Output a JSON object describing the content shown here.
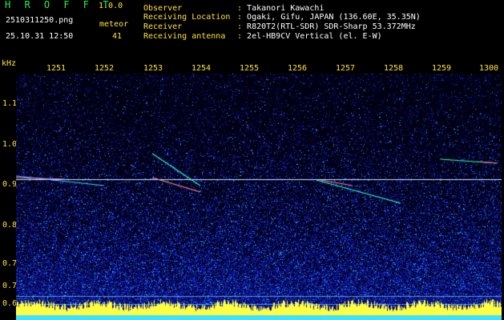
{
  "app": {
    "name": "H R O F F T",
    "version": "1.0.0"
  },
  "file": "2510311250.png",
  "timestamp": "25.10.31 12:50",
  "meteor": {
    "label": "meteor",
    "count": "41"
  },
  "info": [
    {
      "label": "Observer",
      "value": "Takanori Kawachi"
    },
    {
      "label": "Receiving Location",
      "value": "Ogaki, Gifu, JAPAN (136.60E, 35.35N)"
    },
    {
      "label": "Receiver",
      "value": "R820T2(RTL-SDR) SDR-Sharp 53.372MHz"
    },
    {
      "label": "Receiving antenna",
      "value": "2el-HB9CV Vertical (el. E-W)"
    }
  ],
  "axis": {
    "y_unit": "kHz",
    "y_ticks": [
      "1.1",
      "1.0",
      "0.9",
      "0.8",
      "0.75",
      "0.7",
      "0.6"
    ],
    "x_ticks": [
      "1251",
      "1252",
      "1253",
      "1254",
      "1255",
      "1256",
      "1257",
      "1258",
      "1259",
      "1300"
    ]
  },
  "colors": {
    "label": "#ffe23a",
    "title": "#28f04a",
    "carrier": "#ffffff"
  }
}
